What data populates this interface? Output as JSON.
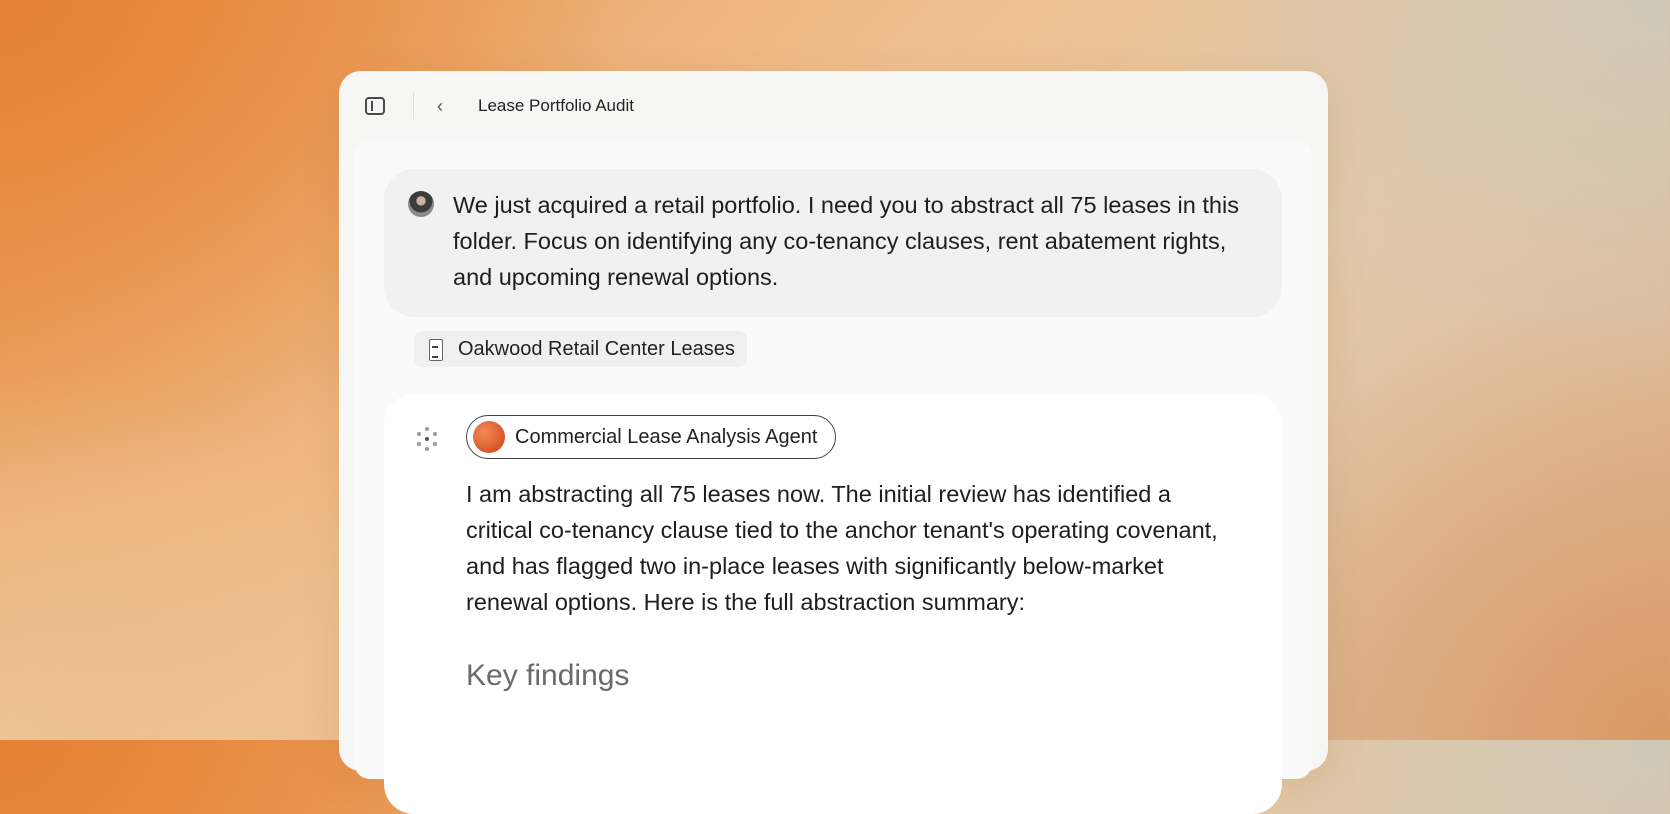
{
  "window": {
    "title": "Lease Portfolio Audit",
    "icons": {
      "sidebar_toggle": "sidebar-toggle-icon",
      "back": "chevron-left-icon"
    }
  },
  "conversation": {
    "user_message": "We just acquired a retail portfolio. I need you to abstract all 75 leases in this folder. Focus on identifying any co-tenancy clauses, rent abatement rights, and upcoming renewal options.",
    "attachment": {
      "label": "Oakwood Retail Center Leases",
      "icon": "document-icon"
    },
    "agent": {
      "name": "Commercial Lease Analysis Agent",
      "message": "I am abstracting all 75 leases now. The initial review has identified a critical co-tenancy clause tied to the anchor tenant's operating covenant, and has flagged two in-place leases with significantly below-market renewal options. Here is the full abstraction summary:",
      "section_heading": "Key findings"
    }
  },
  "colors": {
    "accent": "#d9562a",
    "background_warm": "#e8934a"
  }
}
